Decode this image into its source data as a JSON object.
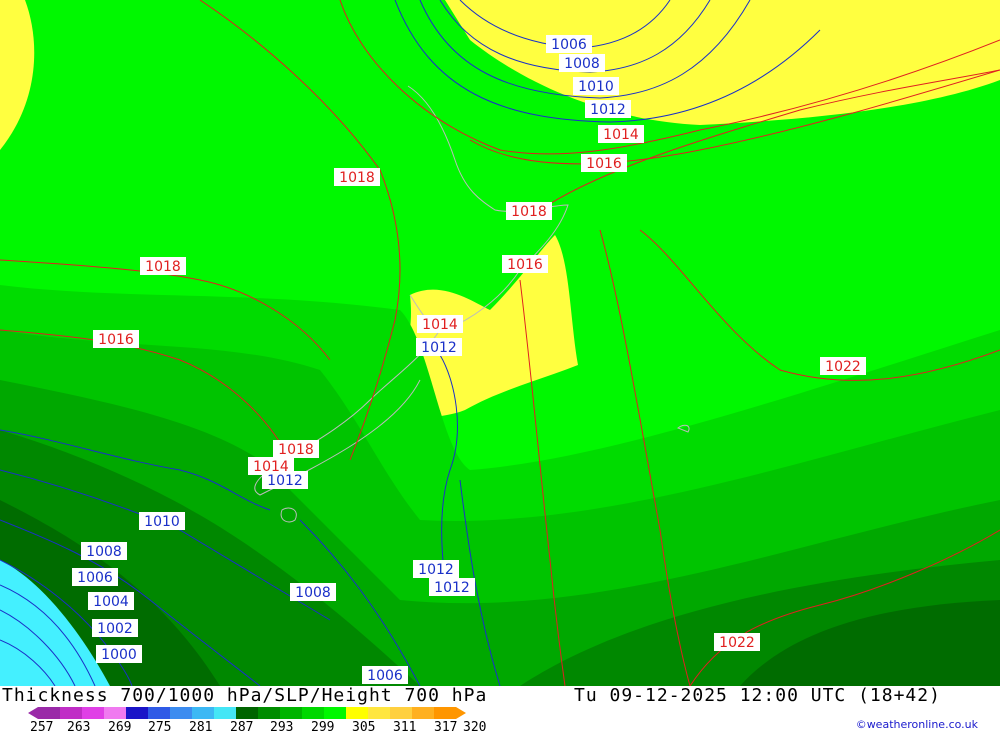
{
  "title": "Thickness 700/1000 hPa/SLP/Height 700 hPa",
  "valid_time": "Tu 09-12-2025 12:00 UTC (18+42)",
  "credit": "©weatheronline.co.uk",
  "legend": {
    "ticks": [
      "257",
      "263",
      "269",
      "275",
      "281",
      "287",
      "293",
      "299",
      "305",
      "311",
      "317",
      "320"
    ],
    "colors": [
      "#9a2aa8",
      "#c02ec6",
      "#e040e6",
      "#f07af0",
      "#1a14c8",
      "#2f5ae6",
      "#3c8cf0",
      "#3cb8f4",
      "#44e6f6",
      "#006400",
      "#008c00",
      "#00b400",
      "#00d800",
      "#00f800",
      "#ffff00",
      "#ffe640",
      "#ffd040",
      "#ffb020",
      "#ff9600"
    ]
  },
  "isobar_labels": {
    "red": [
      {
        "text": "1018"
      },
      {
        "text": "1018"
      },
      {
        "text": "1018"
      },
      {
        "text": "1016"
      },
      {
        "text": "1016"
      },
      {
        "text": "1016"
      },
      {
        "text": "1014"
      },
      {
        "text": "1014"
      },
      {
        "text": "1022"
      },
      {
        "text": "1022"
      },
      {
        "text": "1018"
      },
      {
        "text": "1014"
      }
    ],
    "blue": [
      {
        "text": "1006"
      },
      {
        "text": "1008"
      },
      {
        "text": "1010"
      },
      {
        "text": "1012"
      },
      {
        "text": "1012"
      },
      {
        "text": "1012"
      },
      {
        "text": "1010"
      },
      {
        "text": "1008"
      },
      {
        "text": "1006"
      },
      {
        "text": "1004"
      },
      {
        "text": "1002"
      },
      {
        "text": "1000"
      },
      {
        "text": "1008"
      },
      {
        "text": "1012"
      },
      {
        "text": "1012"
      },
      {
        "text": "1006"
      }
    ]
  },
  "colors": {
    "isobar_red": "#e02020",
    "isobar_blue": "#1a30c8",
    "land_outline": "#bcbcbc"
  }
}
